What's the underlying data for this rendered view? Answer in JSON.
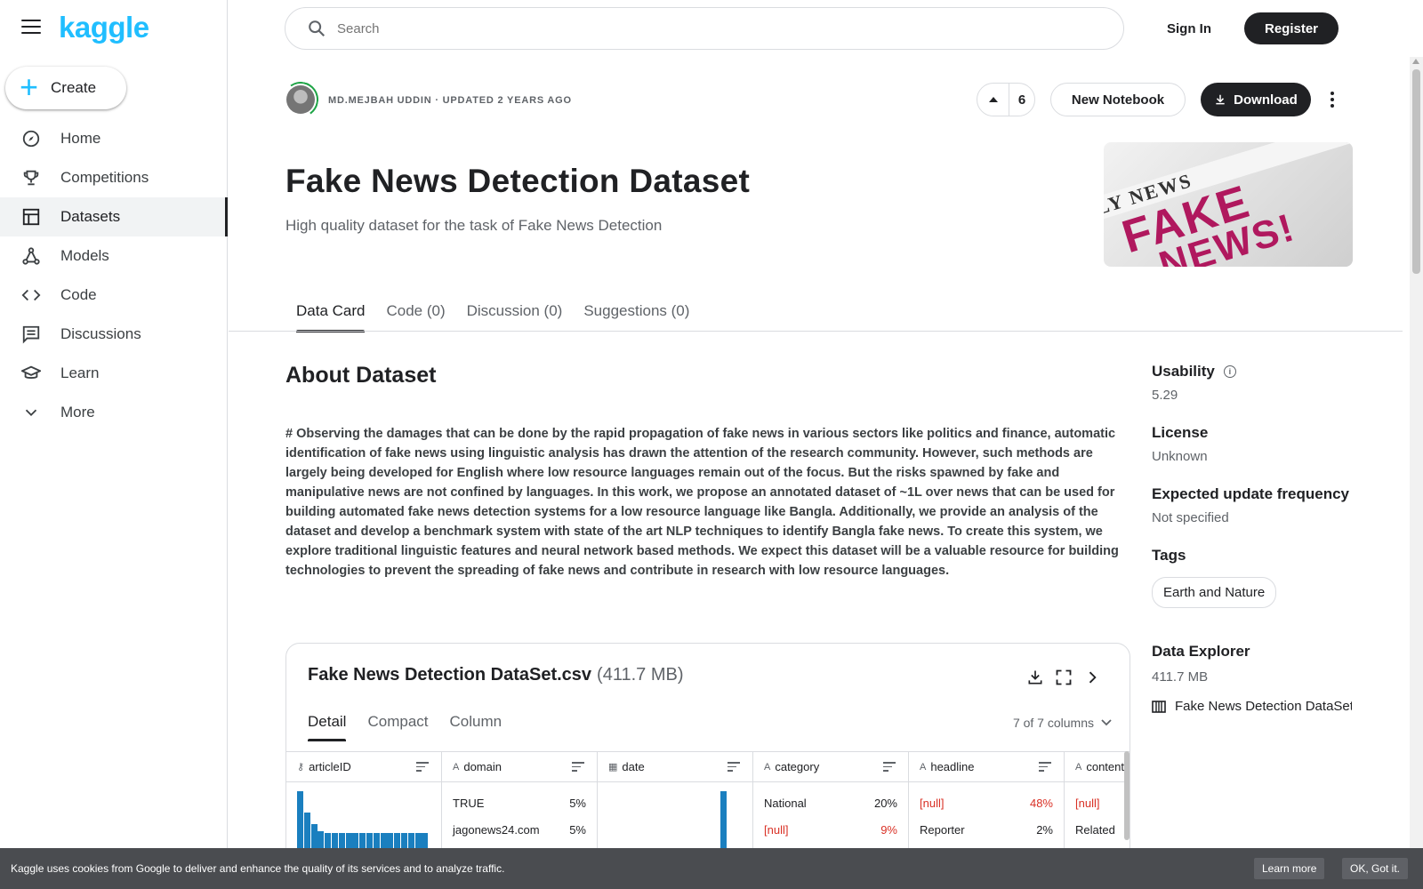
{
  "sidebar": {
    "logo": "kaggle",
    "create_label": "Create",
    "items": [
      {
        "label": "Home",
        "icon": "compass-icon"
      },
      {
        "label": "Competitions",
        "icon": "trophy-icon"
      },
      {
        "label": "Datasets",
        "icon": "table-icon",
        "active": true
      },
      {
        "label": "Models",
        "icon": "models-icon"
      },
      {
        "label": "Code",
        "icon": "code-icon"
      },
      {
        "label": "Discussions",
        "icon": "comment-icon"
      },
      {
        "label": "Learn",
        "icon": "school-icon"
      },
      {
        "label": "More",
        "icon": "chevron-down-icon"
      }
    ]
  },
  "header": {
    "search_placeholder": "Search",
    "signin_label": "Sign In",
    "register_label": "Register"
  },
  "dataset": {
    "meta": "MD.MEJBAH UDDIN · UPDATED 2 YEARS AGO",
    "vote_count": "6",
    "new_notebook_label": "New Notebook",
    "download_label": "Download",
    "title": "Fake News Detection Dataset",
    "subtitle": "High quality dataset for the task of Fake News Detection",
    "cover": {
      "strip": "LY NEWS",
      "line1": "FAKE",
      "line2": "NEWS!",
      "accent": "#b0185e"
    },
    "tabs": [
      "Data Card",
      "Code (0)",
      "Discussion (0)",
      "Suggestions (0)"
    ]
  },
  "about": {
    "heading": "About Dataset",
    "text": "# Observing the damages that can be done by the rapid propagation of fake news in various sectors like politics and finance, automatic identification of fake news using linguistic analysis has drawn the attention of the research community. However, such methods are largely being developed for English where low resource languages remain out of the focus. But the risks spawned by fake and manipulative news are not confined by languages. In this work, we propose an annotated dataset of ~1L over news that can be used for building automated fake news detection systems for a low resource language like Bangla. Additionally, we provide an analysis of the dataset and develop a benchmark system with state of the art NLP techniques to identify Bangla fake news. To create this system, we explore traditional linguistic features and neural network based methods. We expect this dataset will be a valuable resource for building technologies to prevent the spreading of fake news and contribute in research with low resource languages."
  },
  "right_meta": {
    "usability_label": "Usability",
    "usability_value": "5.29",
    "license_label": "License",
    "license_value": "Unknown",
    "freq_label": "Expected update frequency",
    "freq_value": "Not specified",
    "tags_label": "Tags",
    "tag": "Earth and Nature",
    "explorer_label": "Data Explorer",
    "explorer_size": "411.7 MB",
    "explorer_file": "Fake News Detection DataSet"
  },
  "file_card": {
    "name": "Fake News Detection DataSet.csv",
    "size": "(411.7 MB)",
    "tabs": [
      "Detail",
      "Compact",
      "Column"
    ],
    "columns_selector": "7 of 7 columns",
    "columns": [
      {
        "name": "articleID",
        "type_icon": "key-icon"
      },
      {
        "name": "domain",
        "type_icon": "string-icon",
        "rows": [
          [
            "TRUE",
            "5%"
          ],
          [
            "jagonews24.com",
            "5%"
          ]
        ]
      },
      {
        "name": "date",
        "type_icon": "calendar-icon"
      },
      {
        "name": "category",
        "type_icon": "string-icon",
        "rows": [
          [
            "National",
            "20%"
          ],
          [
            "[null]",
            "9%"
          ]
        ]
      },
      {
        "name": "headline",
        "type_icon": "string-icon",
        "rows": [
          [
            "[null]",
            "48%"
          ],
          [
            "Reporter",
            "2%"
          ]
        ]
      },
      {
        "name": "content",
        "type_icon": "string-icon",
        "rows": [
          [
            "[null]",
            ""
          ],
          [
            "Related",
            ""
          ]
        ]
      }
    ],
    "histogram_levels": [
      1.0,
      0.62,
      0.42,
      0.3,
      0.26,
      0.26,
      0.26,
      0.26,
      0.27,
      0.26,
      0.26,
      0.27,
      0.27,
      0.26,
      0.26,
      0.26,
      0.27,
      0.27,
      0.27
    ]
  },
  "cookie": {
    "text": "Kaggle uses cookies from Google to deliver and enhance the quality of its services and to analyze traffic.",
    "learn_more": "Learn more",
    "ok": "OK, Got it."
  },
  "colors": {
    "brand": "#20beff",
    "dark": "#202124",
    "hist_bar": "#1a7fbf",
    "null": "#d93025"
  }
}
